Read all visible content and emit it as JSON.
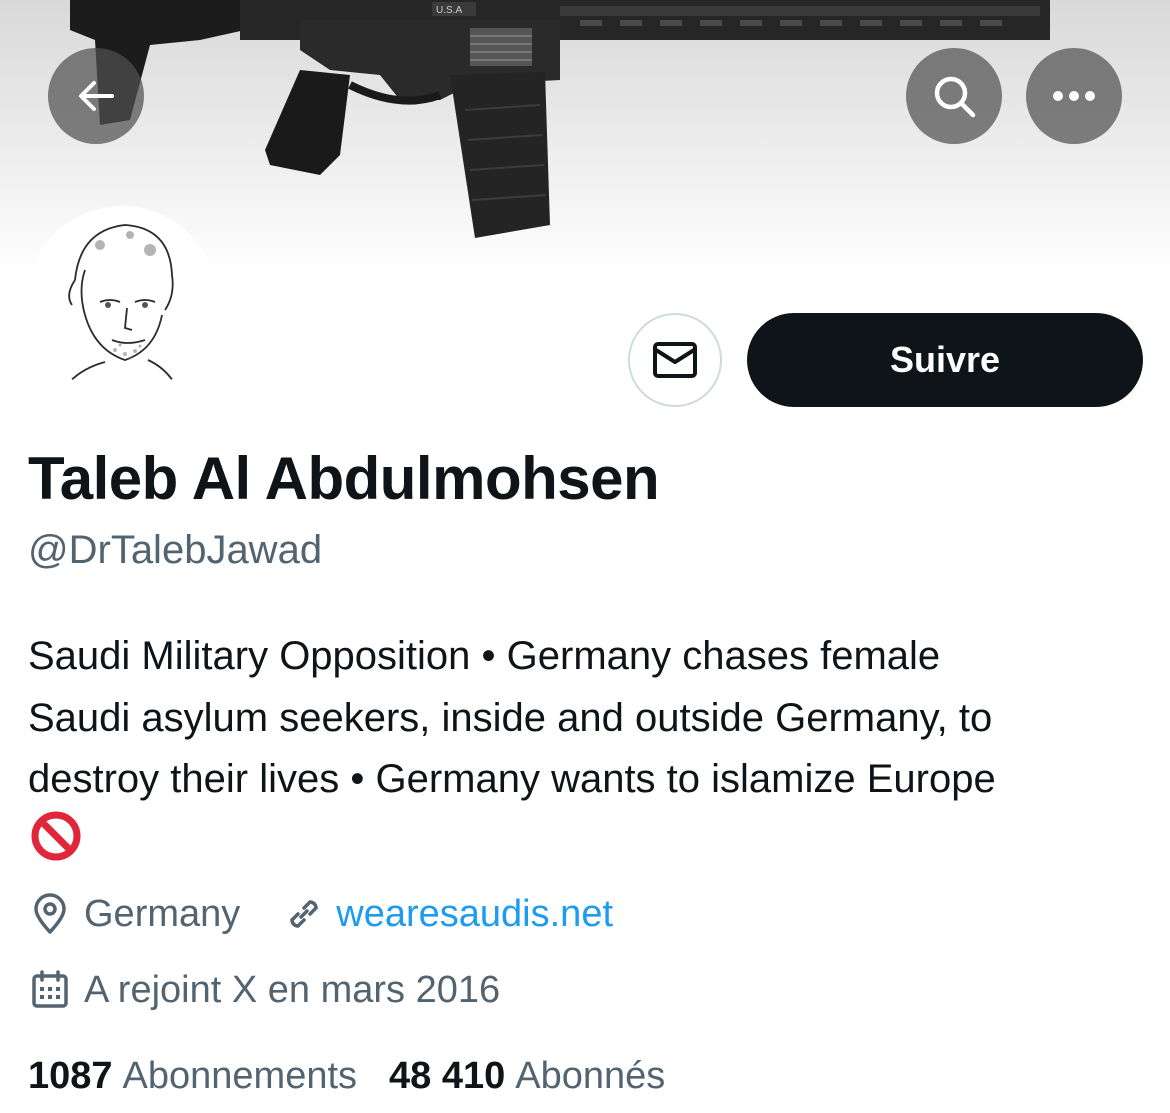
{
  "header": {
    "back_icon": "arrow-left-icon",
    "search_icon": "search-icon",
    "more_icon": "more-horizontal-icon",
    "banner_text": "U.S.A"
  },
  "actions": {
    "message_icon": "envelope-icon",
    "follow_label": "Suivre"
  },
  "profile": {
    "name": "Taleb Al Abdulmohsen",
    "handle": "@DrTalebJawad",
    "bio_lines": [
      "Saudi Military Opposition • Germany chases female",
      "Saudi asylum seekers, inside and outside Germany, to",
      "destroy their lives • Germany wants to islamize Europe"
    ],
    "bio_emoji": "prohibited-emoji",
    "location": "Germany",
    "location_icon": "location-pin-icon",
    "website": "wearesaudis.net",
    "website_icon": "link-icon",
    "joined": "A rejoint X en mars 2016",
    "joined_icon": "calendar-icon"
  },
  "stats": {
    "following_count": "1087",
    "following_label": "Abonnements",
    "followers_count": "48 410",
    "followers_label": "Abonnés"
  },
  "colors": {
    "text": "#0f1419",
    "secondary": "#536471",
    "link": "#1d9bf0",
    "button_dark": "#0f1419",
    "prohibited_red": "#e0263a"
  }
}
